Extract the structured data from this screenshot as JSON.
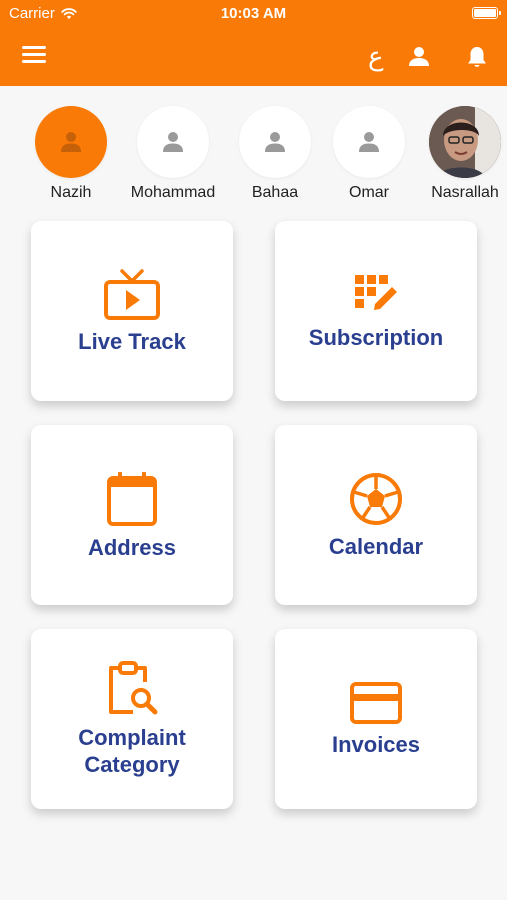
{
  "status_bar": {
    "carrier": "Carrier",
    "time": "10:03 AM"
  },
  "header": {
    "language_label": "ع",
    "accent_color": "#f97a06"
  },
  "users": [
    {
      "name": "Nazih",
      "active": true
    },
    {
      "name": "Mohammad",
      "active": false
    },
    {
      "name": "Bahaa",
      "active": false
    },
    {
      "name": "Omar",
      "active": false
    },
    {
      "name": "Nasrallah",
      "active": false
    }
  ],
  "tiles": [
    {
      "label": "Live Track",
      "icon": "tv-play-icon"
    },
    {
      "label": "Subscription",
      "icon": "grid-edit-icon"
    },
    {
      "label": "Address",
      "icon": "calendar-icon"
    },
    {
      "label": "Calendar",
      "icon": "football-icon"
    },
    {
      "label": "Complaint Category",
      "icon": "clipboard-search-icon"
    },
    {
      "label": "Invoices",
      "icon": "credit-card-icon"
    }
  ],
  "colors": {
    "accent": "#f97a06",
    "label": "#2a3f8f",
    "background": "#f7f7f7"
  }
}
